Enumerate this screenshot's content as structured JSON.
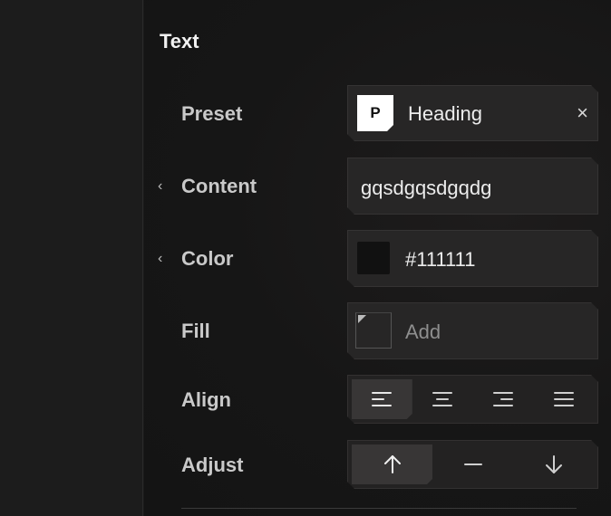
{
  "section": {
    "title": "Text"
  },
  "preset": {
    "label": "Preset",
    "badge": "P",
    "value": "Heading",
    "clear": "×"
  },
  "content": {
    "label": "Content",
    "value": "gqsdgqsdgqdg"
  },
  "color": {
    "label": "Color",
    "value": "#111111",
    "swatch": "#111111"
  },
  "fill": {
    "label": "Fill",
    "placeholder": "Add"
  },
  "align": {
    "label": "Align",
    "options": [
      "align-left",
      "align-center",
      "align-right",
      "justify"
    ],
    "selected": "align-left"
  },
  "adjust": {
    "label": "Adjust",
    "options": [
      "arrow-up",
      "minus",
      "arrow-down"
    ],
    "selected": "arrow-up"
  },
  "icons": {
    "chevron": "‹"
  },
  "colors": {
    "accent_text": "#ececec",
    "label": "#c9c9c9",
    "field_bg": "#272626"
  }
}
